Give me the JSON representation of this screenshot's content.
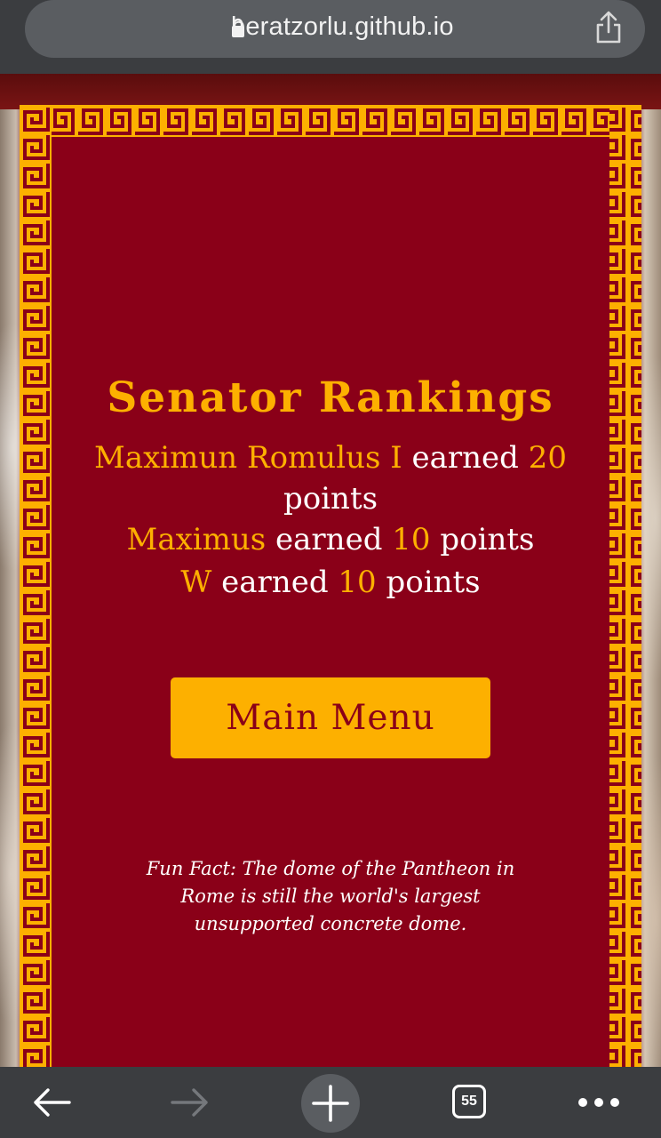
{
  "browser": {
    "url": "beratzorlu.github.io",
    "tab_count": "55"
  },
  "page": {
    "title": "Senator Rankings",
    "rankings": [
      {
        "name": "Maximun Romulus I",
        "mid": " earned ",
        "points": "20",
        "suffix": " points"
      },
      {
        "name": "Maximus",
        "mid": " earned ",
        "points": "10",
        "suffix": " points"
      },
      {
        "name": "W",
        "mid": " earned ",
        "points": "10",
        "suffix": " points"
      }
    ],
    "main_menu_label": "Main Menu",
    "fun_fact": "Fun Fact: The dome of the Pantheon in Rome is still the world's largest unsupported concrete dome."
  },
  "colors": {
    "crimson": "#8a0018",
    "gold": "#fdb000",
    "chrome": "#3b3d40"
  },
  "icons": [
    "lock-icon",
    "share-icon",
    "back-arrow-icon",
    "forward-arrow-icon",
    "new-tab-icon",
    "tabs-icon",
    "more-icon"
  ]
}
